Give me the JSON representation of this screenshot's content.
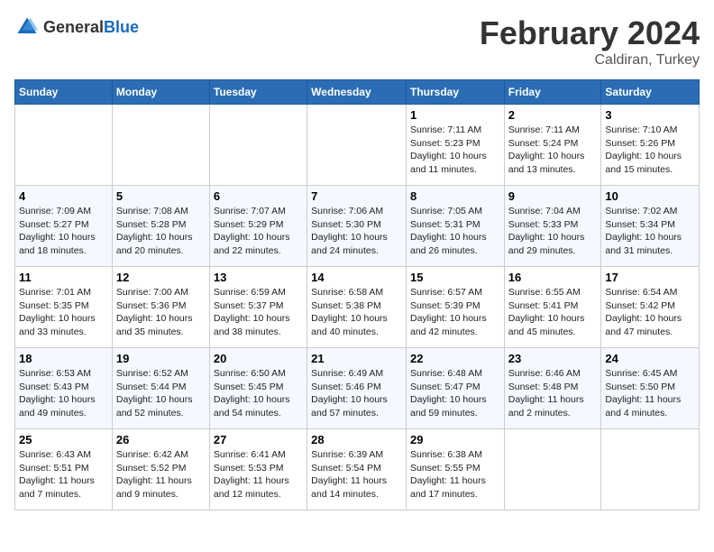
{
  "header": {
    "logo_general": "General",
    "logo_blue": "Blue",
    "month": "February 2024",
    "location": "Caldiran, Turkey"
  },
  "days_of_week": [
    "Sunday",
    "Monday",
    "Tuesday",
    "Wednesday",
    "Thursday",
    "Friday",
    "Saturday"
  ],
  "weeks": [
    [
      {
        "day": "",
        "text": ""
      },
      {
        "day": "",
        "text": ""
      },
      {
        "day": "",
        "text": ""
      },
      {
        "day": "",
        "text": ""
      },
      {
        "day": "1",
        "text": "Sunrise: 7:11 AM\nSunset: 5:23 PM\nDaylight: 10 hours\nand 11 minutes."
      },
      {
        "day": "2",
        "text": "Sunrise: 7:11 AM\nSunset: 5:24 PM\nDaylight: 10 hours\nand 13 minutes."
      },
      {
        "day": "3",
        "text": "Sunrise: 7:10 AM\nSunset: 5:26 PM\nDaylight: 10 hours\nand 15 minutes."
      }
    ],
    [
      {
        "day": "4",
        "text": "Sunrise: 7:09 AM\nSunset: 5:27 PM\nDaylight: 10 hours\nand 18 minutes."
      },
      {
        "day": "5",
        "text": "Sunrise: 7:08 AM\nSunset: 5:28 PM\nDaylight: 10 hours\nand 20 minutes."
      },
      {
        "day": "6",
        "text": "Sunrise: 7:07 AM\nSunset: 5:29 PM\nDaylight: 10 hours\nand 22 minutes."
      },
      {
        "day": "7",
        "text": "Sunrise: 7:06 AM\nSunset: 5:30 PM\nDaylight: 10 hours\nand 24 minutes."
      },
      {
        "day": "8",
        "text": "Sunrise: 7:05 AM\nSunset: 5:31 PM\nDaylight: 10 hours\nand 26 minutes."
      },
      {
        "day": "9",
        "text": "Sunrise: 7:04 AM\nSunset: 5:33 PM\nDaylight: 10 hours\nand 29 minutes."
      },
      {
        "day": "10",
        "text": "Sunrise: 7:02 AM\nSunset: 5:34 PM\nDaylight: 10 hours\nand 31 minutes."
      }
    ],
    [
      {
        "day": "11",
        "text": "Sunrise: 7:01 AM\nSunset: 5:35 PM\nDaylight: 10 hours\nand 33 minutes."
      },
      {
        "day": "12",
        "text": "Sunrise: 7:00 AM\nSunset: 5:36 PM\nDaylight: 10 hours\nand 35 minutes."
      },
      {
        "day": "13",
        "text": "Sunrise: 6:59 AM\nSunset: 5:37 PM\nDaylight: 10 hours\nand 38 minutes."
      },
      {
        "day": "14",
        "text": "Sunrise: 6:58 AM\nSunset: 5:38 PM\nDaylight: 10 hours\nand 40 minutes."
      },
      {
        "day": "15",
        "text": "Sunrise: 6:57 AM\nSunset: 5:39 PM\nDaylight: 10 hours\nand 42 minutes."
      },
      {
        "day": "16",
        "text": "Sunrise: 6:55 AM\nSunset: 5:41 PM\nDaylight: 10 hours\nand 45 minutes."
      },
      {
        "day": "17",
        "text": "Sunrise: 6:54 AM\nSunset: 5:42 PM\nDaylight: 10 hours\nand 47 minutes."
      }
    ],
    [
      {
        "day": "18",
        "text": "Sunrise: 6:53 AM\nSunset: 5:43 PM\nDaylight: 10 hours\nand 49 minutes."
      },
      {
        "day": "19",
        "text": "Sunrise: 6:52 AM\nSunset: 5:44 PM\nDaylight: 10 hours\nand 52 minutes."
      },
      {
        "day": "20",
        "text": "Sunrise: 6:50 AM\nSunset: 5:45 PM\nDaylight: 10 hours\nand 54 minutes."
      },
      {
        "day": "21",
        "text": "Sunrise: 6:49 AM\nSunset: 5:46 PM\nDaylight: 10 hours\nand 57 minutes."
      },
      {
        "day": "22",
        "text": "Sunrise: 6:48 AM\nSunset: 5:47 PM\nDaylight: 10 hours\nand 59 minutes."
      },
      {
        "day": "23",
        "text": "Sunrise: 6:46 AM\nSunset: 5:48 PM\nDaylight: 11 hours\nand 2 minutes."
      },
      {
        "day": "24",
        "text": "Sunrise: 6:45 AM\nSunset: 5:50 PM\nDaylight: 11 hours\nand 4 minutes."
      }
    ],
    [
      {
        "day": "25",
        "text": "Sunrise: 6:43 AM\nSunset: 5:51 PM\nDaylight: 11 hours\nand 7 minutes."
      },
      {
        "day": "26",
        "text": "Sunrise: 6:42 AM\nSunset: 5:52 PM\nDaylight: 11 hours\nand 9 minutes."
      },
      {
        "day": "27",
        "text": "Sunrise: 6:41 AM\nSunset: 5:53 PM\nDaylight: 11 hours\nand 12 minutes."
      },
      {
        "day": "28",
        "text": "Sunrise: 6:39 AM\nSunset: 5:54 PM\nDaylight: 11 hours\nand 14 minutes."
      },
      {
        "day": "29",
        "text": "Sunrise: 6:38 AM\nSunset: 5:55 PM\nDaylight: 11 hours\nand 17 minutes."
      },
      {
        "day": "",
        "text": ""
      },
      {
        "day": "",
        "text": ""
      }
    ]
  ]
}
